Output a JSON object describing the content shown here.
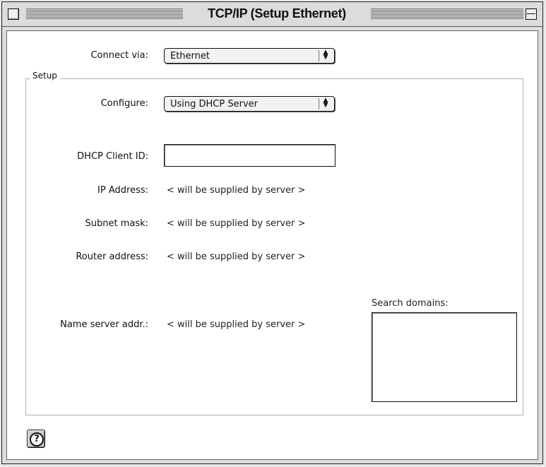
{
  "window": {
    "title": "TCP/IP (Setup Ethernet)"
  },
  "connect_via": {
    "label": "Connect via:",
    "value": "Ethernet"
  },
  "setup": {
    "group_label": "Setup",
    "configure": {
      "label": "Configure:",
      "value": "Using DHCP Server"
    },
    "dhcp_client_id": {
      "label": "DHCP Client ID:",
      "value": ""
    },
    "ip_address": {
      "label": "IP Address:",
      "value": "< will be supplied by server >"
    },
    "subnet_mask": {
      "label": "Subnet mask:",
      "value": "< will be supplied by server >"
    },
    "router_address": {
      "label": "Router address:",
      "value": "< will be supplied by server >"
    },
    "name_server": {
      "label": "Name server addr.:",
      "value": "< will be supplied by server >"
    },
    "search_domains": {
      "label": "Search domains:",
      "value": ""
    }
  },
  "help": {
    "symbol": "?"
  }
}
